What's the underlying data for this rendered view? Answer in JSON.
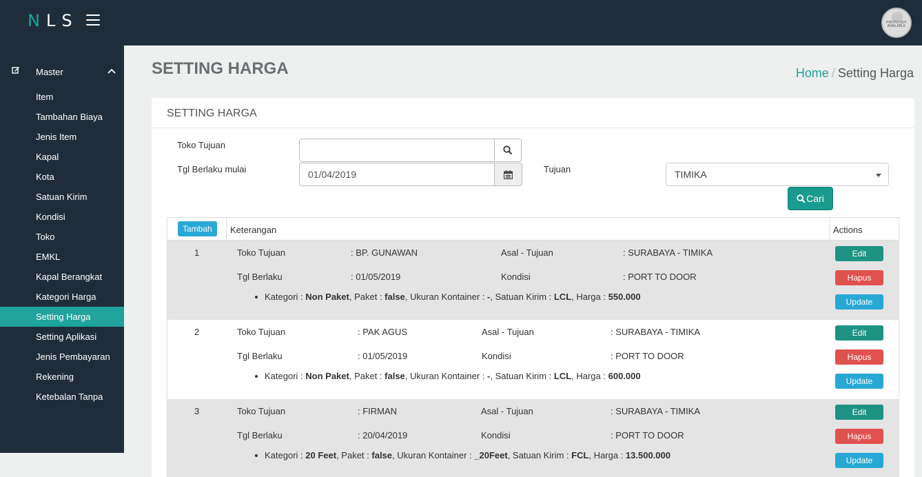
{
  "app": {
    "logo_n": "N",
    "logo_rest": "LS"
  },
  "avatar": {
    "text": "PHOTO NOT AVAILABLE"
  },
  "sidebar": {
    "group_label": "Master",
    "items": [
      {
        "label": "Item"
      },
      {
        "label": "Tambahan Biaya"
      },
      {
        "label": "Jenis Item"
      },
      {
        "label": "Kapal"
      },
      {
        "label": "Kota"
      },
      {
        "label": "Satuan Kirim"
      },
      {
        "label": "Kondisi"
      },
      {
        "label": "Toko"
      },
      {
        "label": "EMKL"
      },
      {
        "label": "Kapal Berangkat"
      },
      {
        "label": "Kategori Harga"
      },
      {
        "label": "Setting Harga",
        "active": true
      },
      {
        "label": "Setting Aplikasi"
      },
      {
        "label": "Jenis Pembayaran"
      },
      {
        "label": "Rekening"
      },
      {
        "label": "Ketebalan Tanpa"
      }
    ]
  },
  "page": {
    "title": "SETTING HARGA"
  },
  "breadcrumb": {
    "home": "Home",
    "separator": "/",
    "current": "Setting Harga"
  },
  "panel": {
    "title": "SETTING HARGA"
  },
  "form": {
    "toko_label": "Toko Tujuan",
    "toko_value": "",
    "tgl_label": "Tgl Berlaku mulai",
    "tgl_value": "01/04/2019",
    "tujuan_label": "Tujuan",
    "tujuan_value": "TIMIKA",
    "cari_label": "Cari"
  },
  "table": {
    "tambah_label": "Tambah",
    "col_keterangan": "Keterangan",
    "col_actions": "Actions",
    "labels": {
      "toko": "Toko Tujuan",
      "asal": "Asal - Tujuan",
      "tgl": "Tgl Berlaku",
      "kondisi": "Kondisi",
      "kategori": "Kategori : ",
      "paket": ", Paket : ",
      "ukuran": ", Ukuran Kontainer : ",
      "satuan": ", Satuan Kirim : ",
      "harga": ", Harga : "
    },
    "actions": {
      "edit": "Edit",
      "hapus": "Hapus",
      "update": "Update"
    },
    "rows": [
      {
        "no": "1",
        "toko": ": BP. GUNAWAN",
        "asal": ": SURABAYA - TIMIKA",
        "tgl": ": 01/05/2019",
        "kondisi": ": PORT TO DOOR",
        "kategori": "Non Paket",
        "paket": "false",
        "ukuran": "-",
        "satuan": "LCL",
        "harga": "550.000"
      },
      {
        "no": "2",
        "toko": ": PAK AGUS",
        "asal": ": SURABAYA - TIMIKA",
        "tgl": ": 01/05/2019",
        "kondisi": ": PORT TO DOOR",
        "kategori": "Non Paket",
        "paket": "false",
        "ukuran": "-",
        "satuan": "LCL",
        "harga": "600.000"
      },
      {
        "no": "3",
        "toko": ": FIRMAN",
        "asal": ": SURABAYA - TIMIKA",
        "tgl": ": 20/04/2019",
        "kondisi": ": PORT TO DOOR",
        "kategori": "20 Feet",
        "paket": "false",
        "ukuran": "_20Feet",
        "satuan": "FCL",
        "harga": "13.500.000"
      }
    ]
  },
  "colors": {
    "sidebar_bg": "#1f2d3a",
    "accent": "#1fa39a",
    "edit": "#1e9384",
    "hapus": "#e0514f",
    "update": "#28a8d5"
  }
}
